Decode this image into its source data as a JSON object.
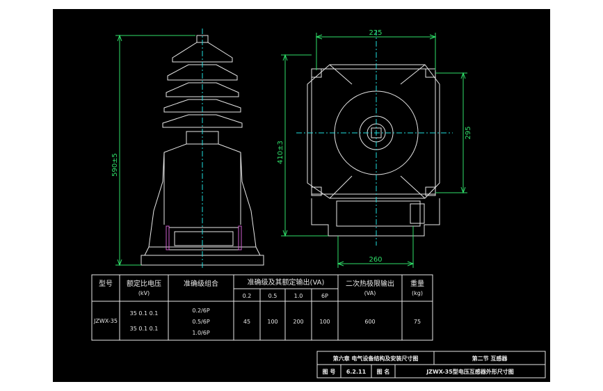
{
  "dimensions": {
    "height_total": "590±5",
    "height_side": "410±3",
    "width_top": "225",
    "width_right": "295",
    "width_bottom": "260"
  },
  "spec_table": {
    "headers": {
      "model": "型号",
      "ratio_line1": "额定比电压",
      "ratio_line2": "(kV)",
      "accuracy_combo": "准确级组合",
      "accuracy_output": "准确级及其额定输出(VA)",
      "thermal_line1": "二次热极限输出",
      "thermal_line2": "(VA)",
      "weight_line1": "重量",
      "weight_line2": "(kg)"
    },
    "sub_headers": [
      "0.2",
      "0.5",
      "1.0",
      "6P"
    ],
    "row": {
      "model": "JZWX-35",
      "ratio_a": "35  0.1  0.1",
      "ratio_b": "35  0.1  0.1",
      "combos": [
        "0.2/6P",
        "0.5/6P",
        "1.0/6P"
      ],
      "outputs": [
        "45",
        "100",
        "200",
        "100"
      ],
      "thermal": "600",
      "weight": "75"
    }
  },
  "title_block": {
    "chapter": "第六章  电气设备结构及安装尺寸图",
    "section": "第二节  互感器",
    "drawing_no_label": "图  号",
    "drawing_no": "6.2.11",
    "drawing_name_label": "图  名",
    "drawing_name": "JZWX-35型电压互感器外形尺寸图"
  },
  "colors": {
    "background": "#000000",
    "outline": "#e8e8e8",
    "dimension": "#2fe06a",
    "centerline": "#20e0e0",
    "accent": "#d060d0"
  }
}
